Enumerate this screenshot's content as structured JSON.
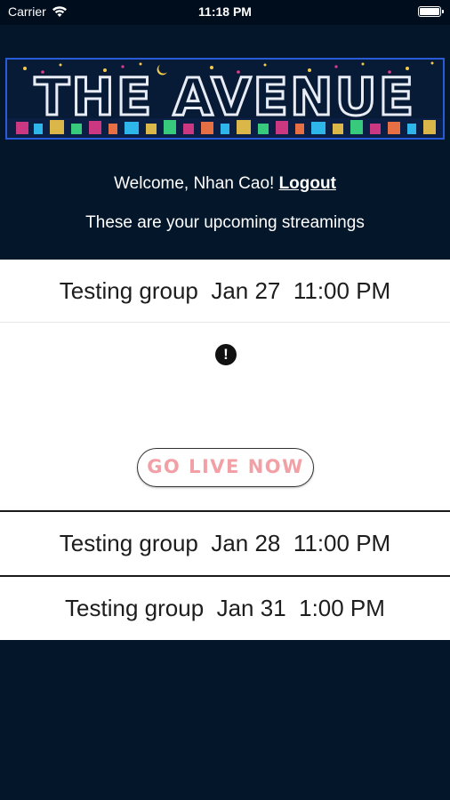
{
  "status_bar": {
    "carrier": "Carrier",
    "time": "11:18 PM",
    "wifi_icon": "wifi-icon",
    "battery_icon": "battery-icon"
  },
  "header": {
    "logo_text": "THE AVENUE",
    "welcome_prefix": "Welcome, Nhan Cao!",
    "logout_label": "Logout",
    "subtitle": "These are your upcoming streamings"
  },
  "streams": [
    {
      "label": "Testing group  Jan 27  11:00 PM",
      "expanded": true
    },
    {
      "label": "Testing group  Jan 28  11:00 PM",
      "expanded": false
    },
    {
      "label": "Testing group  Jan 31  1:00 PM",
      "expanded": false
    }
  ],
  "stream_detail": {
    "alert_icon": "exclamation-circle-icon",
    "alert_symbol": "!",
    "go_live_label": "GO LIVE NOW"
  },
  "colors": {
    "background": "#03162a",
    "go_live_text": "#f2a0a6",
    "logo_border": "#2a5bd7"
  }
}
